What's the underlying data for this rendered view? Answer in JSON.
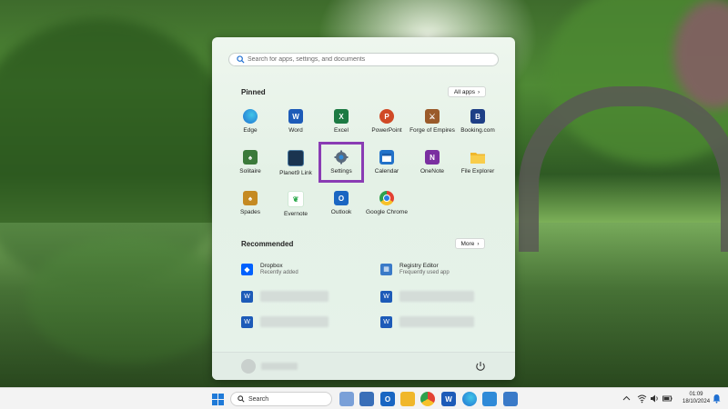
{
  "start_menu": {
    "search": {
      "placeholder": "Search for apps, settings, and documents"
    },
    "pinned": {
      "title": "Pinned",
      "all_apps_label": "All apps",
      "apps": [
        {
          "label": "Edge",
          "icon": "edge-icon",
          "color": "#1f8ad8"
        },
        {
          "label": "Word",
          "icon": "word-icon",
          "color": "#1d5bb8"
        },
        {
          "label": "Excel",
          "icon": "excel-icon",
          "color": "#1c7a43"
        },
        {
          "label": "PowerPoint",
          "icon": "powerpoint-icon",
          "color": "#d04a26"
        },
        {
          "label": "Forge of Empires",
          "icon": "forge-of-empires-icon",
          "color": "#9a5a2a"
        },
        {
          "label": "Booking.com",
          "icon": "booking-icon",
          "color": "#1e3f86"
        },
        {
          "label": "Solitaire",
          "icon": "solitaire-icon",
          "color": "#3b7a3a"
        },
        {
          "label": "Planet9 Link",
          "icon": "planet9-link-icon",
          "color": "#1a3450"
        },
        {
          "label": "Settings",
          "icon": "gear-icon",
          "color": "#5a6a7c"
        },
        {
          "label": "Calendar",
          "icon": "calendar-icon",
          "color": "#2272c9"
        },
        {
          "label": "OneNote",
          "icon": "onenote-icon",
          "color": "#7a2fa0"
        },
        {
          "label": "File Explorer",
          "icon": "folder-icon",
          "color": "#f0b72b"
        },
        {
          "label": "Spades",
          "icon": "spades-icon",
          "color": "#c58a22"
        },
        {
          "label": "Evernote",
          "icon": "evernote-icon",
          "color": "#2aa84a"
        },
        {
          "label": "Outlook",
          "icon": "outlook-icon",
          "color": "#1a66c2"
        },
        {
          "label": "Google Chrome",
          "icon": "chrome-icon",
          "color": "#e34133"
        }
      ]
    },
    "recommended": {
      "title": "Recommended",
      "more_label": "More",
      "items": [
        {
          "title": "Dropbox",
          "subtitle": "Recently added",
          "icon": "dropbox-icon"
        },
        {
          "title": "Registry Editor",
          "subtitle": "Frequently used app",
          "icon": "registry-editor-icon"
        }
      ]
    }
  },
  "taskbar": {
    "search_label": "Search",
    "time": "01:09",
    "date": "18/10/2024"
  },
  "colors": {
    "highlight": "#8a3cb4",
    "accent": "#1f6fd1"
  }
}
